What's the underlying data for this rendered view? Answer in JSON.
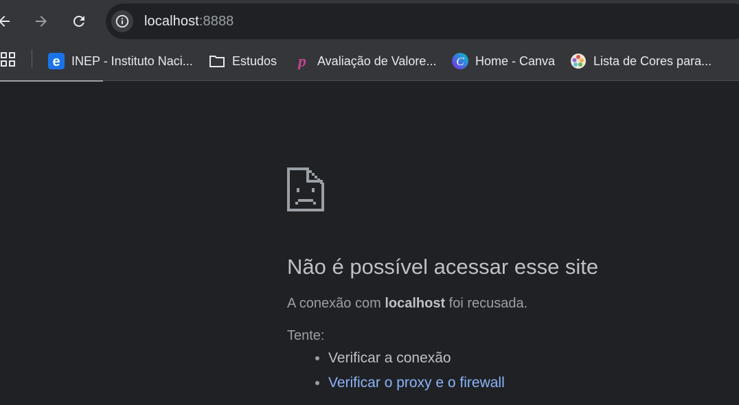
{
  "address_bar": {
    "url_host": "localhost",
    "url_port": ":8888"
  },
  "bookmarks": [
    {
      "label": "INEP - Instituto Naci...",
      "icon": "ie-e-icon"
    },
    {
      "label": "Estudos",
      "icon": "folder-icon"
    },
    {
      "label": "Avaliação de Valore...",
      "icon": "p-logo-icon"
    },
    {
      "label": "Home - Canva",
      "icon": "canva-icon"
    },
    {
      "label": "Lista de Cores para...",
      "icon": "color-wheel-icon"
    }
  ],
  "error_page": {
    "title": "Não é possível acessar esse site",
    "desc_prefix": "A conexão com ",
    "desc_host": "localhost",
    "desc_suffix": " foi recusada.",
    "try_label": "Tente:",
    "suggestions": [
      "Verificar a conexão",
      "Verificar o proxy e o firewall"
    ]
  },
  "colors": {
    "background": "#202124",
    "toolbar": "#35363a",
    "link": "#8ab4f8"
  }
}
